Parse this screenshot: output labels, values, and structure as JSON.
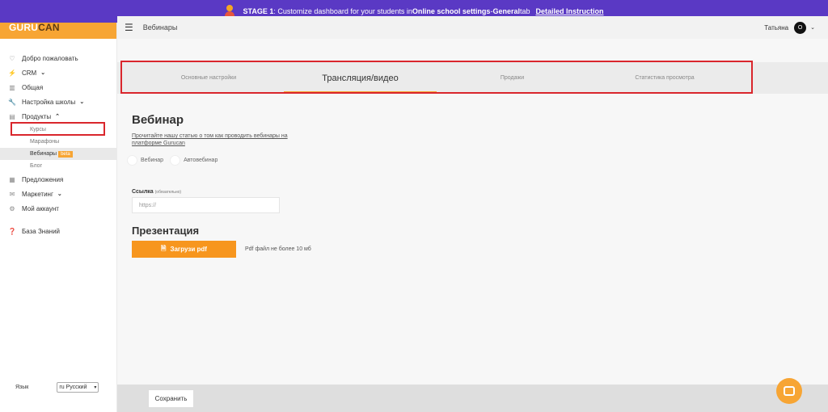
{
  "banner": {
    "stage": "STAGE 1",
    "text_before": ": Customize dashboard for your students in ",
    "bold1": "Online school settings",
    "text_mid": " - ",
    "bold2": "General",
    "text_after": " tab",
    "link": "Detailed Instruction"
  },
  "logo": {
    "part1": "GURU",
    "part2": "CAN"
  },
  "header": {
    "page_name": "Вебинары",
    "user_name": "Татьяна",
    "avatar_letter": "O"
  },
  "sidebar": {
    "items": [
      {
        "icon": "heart-icon",
        "glyph": "♡",
        "label": "Добро пожаловать"
      },
      {
        "icon": "bolt-icon",
        "glyph": "⚡",
        "label": "CRM",
        "chevron": "⌄"
      },
      {
        "icon": "chart-icon",
        "glyph": "▥",
        "label": "Общая"
      },
      {
        "icon": "wrench-icon",
        "glyph": "🔧",
        "label": "Настройка школы",
        "chevron": "⌄"
      },
      {
        "icon": "document-icon",
        "glyph": "▤",
        "label": "Продукты",
        "chevron": "⌃"
      }
    ],
    "sub_items": [
      "Курсы",
      "Марафоны",
      "Вебинары",
      "Блог"
    ],
    "beta": "beta",
    "items2": [
      {
        "icon": "offers-icon",
        "glyph": "▦",
        "label": "Предложения"
      },
      {
        "icon": "mail-icon",
        "glyph": "✉",
        "label": "Маркетинг",
        "chevron": "⌄"
      },
      {
        "icon": "account-icon",
        "glyph": "⚙",
        "label": "Мой аккаунт"
      }
    ],
    "knowledge_base": {
      "icon": "question-icon",
      "glyph": "❓",
      "label": "База Знаний"
    },
    "language_label": "Язык",
    "language_value": "ru Русский"
  },
  "tabs": [
    {
      "label": "Основные настройки",
      "active": false
    },
    {
      "label": "Трансляция/видео",
      "active": true
    },
    {
      "label": "Продажи",
      "active": false
    },
    {
      "label": "Статистика просмотра",
      "active": false
    }
  ],
  "main": {
    "title": "Вебинар",
    "article_link": "Прочитайте нашу статью о том как проводить вебинары на платформе Gurucan",
    "radio_options": [
      "Вебинар",
      "Автовебинар"
    ],
    "link_label": "Ссылка",
    "link_required": "(обязательно)",
    "link_placeholder": "https://",
    "presentation_title": "Презентация",
    "upload_button": "Загрузи pdf",
    "upload_hint": "Pdf файл не более 10 мб"
  },
  "footer": {
    "save_button": "Сохранить"
  },
  "colors": {
    "accent": "#f7a534",
    "banner": "#5a39c4",
    "highlight": "#d9262c"
  }
}
